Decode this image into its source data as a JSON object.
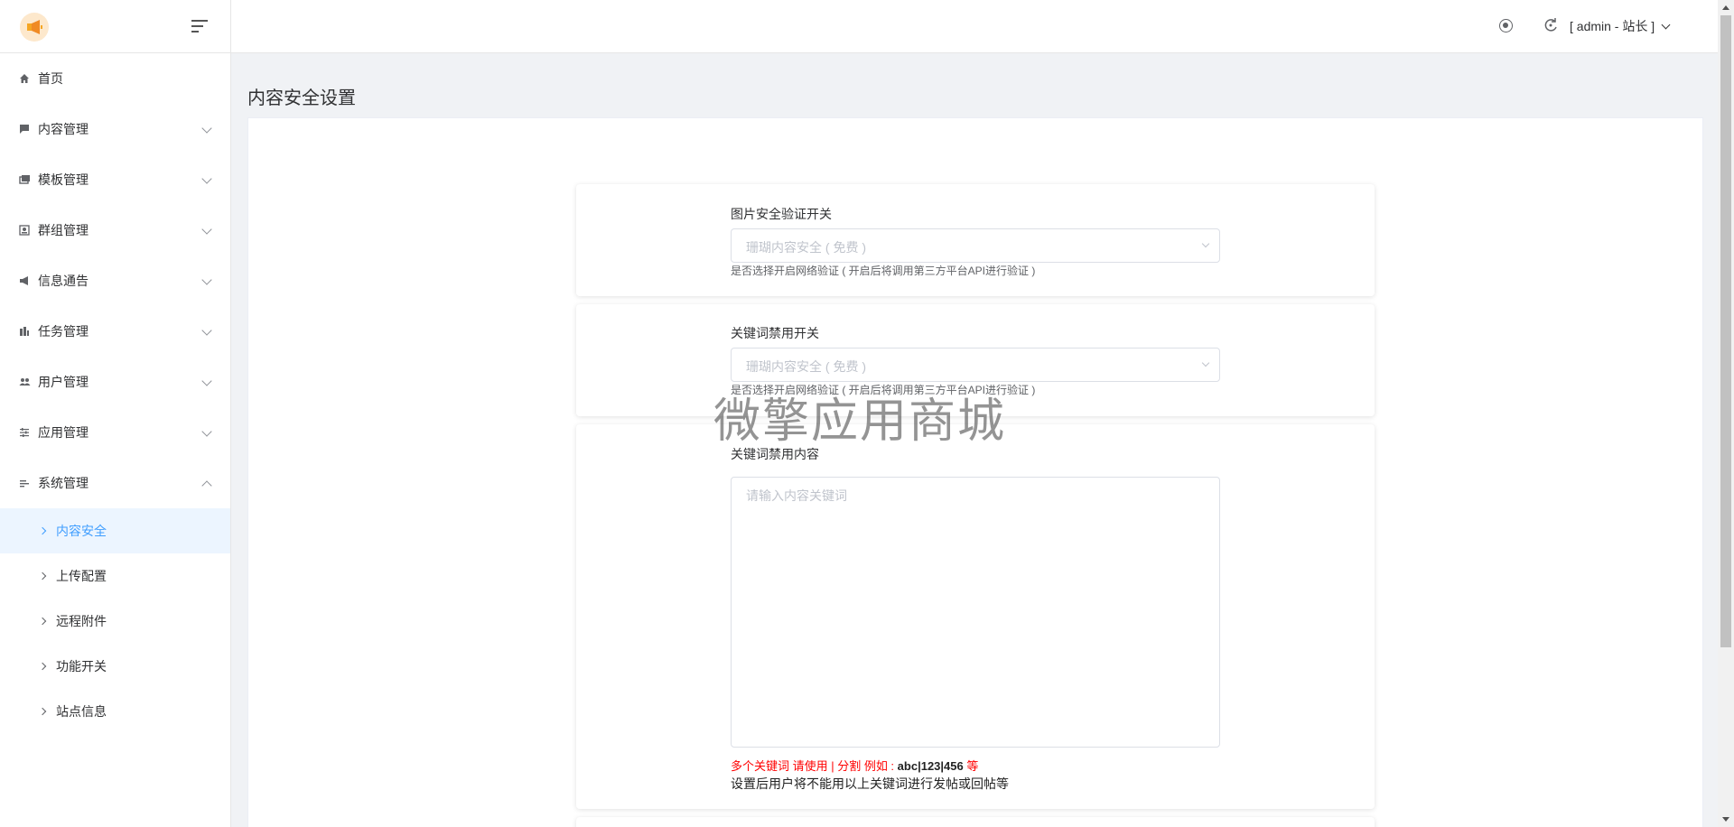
{
  "sidebar": {
    "menu": [
      {
        "label": "首页",
        "icon": "home-icon"
      },
      {
        "label": "内容管理",
        "icon": "comment-icon"
      },
      {
        "label": "模板管理",
        "icon": "template-icon"
      },
      {
        "label": "群组管理",
        "icon": "group-icon"
      },
      {
        "label": "信息通告",
        "icon": "megaphone-icon"
      },
      {
        "label": "任务管理",
        "icon": "task-icon"
      },
      {
        "label": "用户管理",
        "icon": "users-icon"
      },
      {
        "label": "应用管理",
        "icon": "sliders-icon"
      },
      {
        "label": "系统管理",
        "icon": "system-icon"
      }
    ],
    "submenu": [
      {
        "label": "内容安全"
      },
      {
        "label": "上传配置"
      },
      {
        "label": "远程附件"
      },
      {
        "label": "功能开关"
      },
      {
        "label": "站点信息"
      }
    ]
  },
  "header": {
    "user_label": "[ admin - 站长 ]"
  },
  "main": {
    "page_title": "内容安全设置",
    "image_check": {
      "label": "图片安全验证开关",
      "selected": "珊瑚内容安全 ( 免费 )",
      "hint": "是否选择开启网络验证 ( 开启后将调用第三方平台API进行验证 )"
    },
    "keyword_switch": {
      "label": "关键词禁用开关",
      "selected": "珊瑚内容安全 ( 免费 )",
      "hint": "是否选择开启网络验证 ( 开启后将调用第三方平台API进行验证 )"
    },
    "keyword_content": {
      "label": "关键词禁用内容",
      "placeholder": "请输入内容关键词",
      "red_hint_prefix": "多个关键词 请使用 | 分割 例如 : ",
      "red_hint_example": "abc|123|456",
      "red_hint_suffix": " 等",
      "note": "设置后用户将不能用以上关键词进行发帖或回帖等"
    }
  },
  "watermark": "微擎应用商城",
  "colors": {
    "accent": "#409eff",
    "active_bg": "#ecf5ff",
    "warning_red": "#ff0000"
  }
}
